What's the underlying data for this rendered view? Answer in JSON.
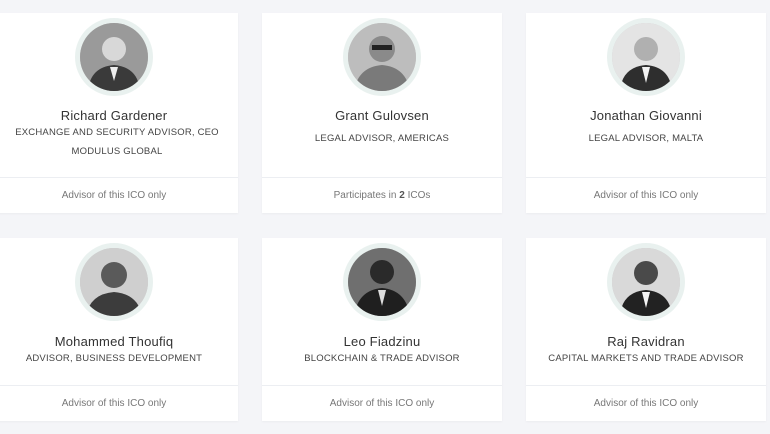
{
  "advisors": [
    {
      "name": "Richard Gardener",
      "role": "EXCHANGE AND SECURITY ADVISOR, CEO MODULUS GLOBAL",
      "footer_prefix": "Advisor of this ICO only",
      "footer_count": "",
      "footer_suffix": "",
      "avatar_icon": "person-avatar-icon"
    },
    {
      "name": "Grant Gulovsen",
      "role": "LEGAL ADVISOR, AMERICAS",
      "footer_prefix": "Participates in ",
      "footer_count": "2",
      "footer_suffix": " ICOs",
      "avatar_icon": "person-avatar-icon"
    },
    {
      "name": "Jonathan Giovanni",
      "role": "LEGAL ADVISOR, MALTA",
      "footer_prefix": "Advisor of this ICO only",
      "footer_count": "",
      "footer_suffix": "",
      "avatar_icon": "person-avatar-icon"
    },
    {
      "name": "Mohammed Thoufiq",
      "role": "ADVISOR, BUSINESS DEVELOPMENT",
      "footer_prefix": "Advisor of this ICO only",
      "footer_count": "",
      "footer_suffix": "",
      "avatar_icon": "person-avatar-icon"
    },
    {
      "name": "Leo Fiadzinu",
      "role": "BLOCKCHAIN & TRADE ADVISOR",
      "footer_prefix": "Advisor of this ICO only",
      "footer_count": "",
      "footer_suffix": "",
      "avatar_icon": "person-avatar-icon"
    },
    {
      "name": "Raj Ravidran",
      "role": "CAPITAL MARKETS AND TRADE ADVISOR",
      "footer_prefix": "Advisor of this ICO only",
      "footer_count": "",
      "footer_suffix": "",
      "avatar_icon": "person-avatar-icon"
    }
  ]
}
